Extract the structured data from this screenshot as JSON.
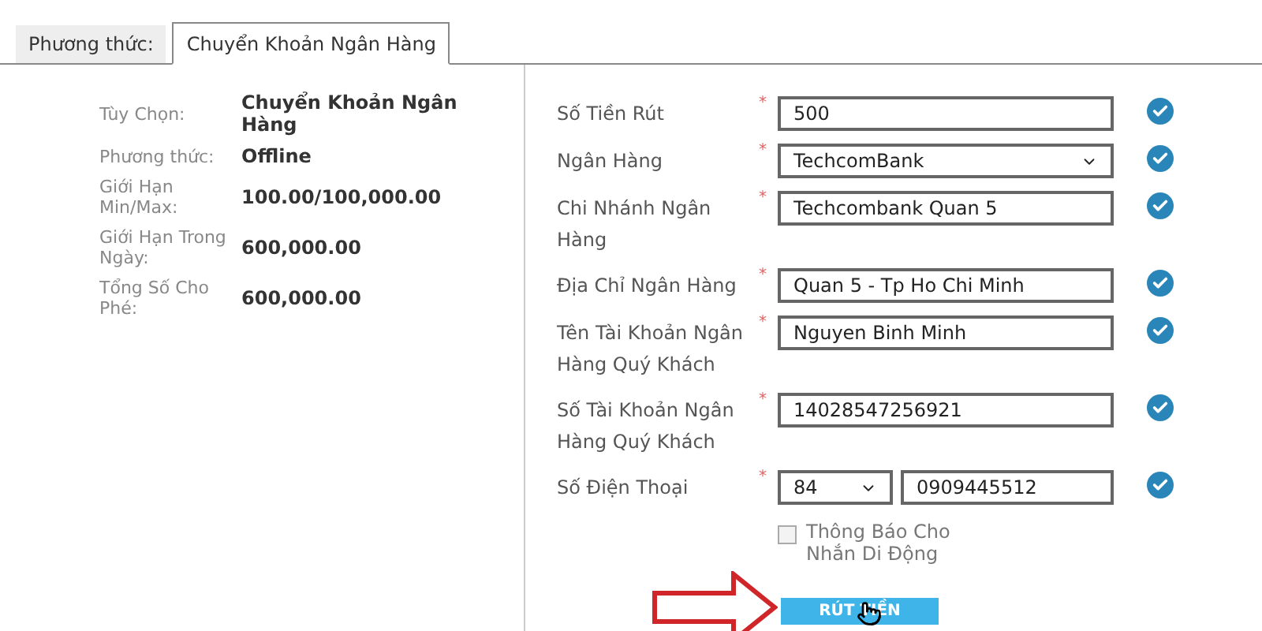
{
  "tabs": [
    {
      "label": "Phương thức:",
      "selected": false
    },
    {
      "label": "Chuyển Khoản Ngân Hàng",
      "selected": true
    }
  ],
  "summary": [
    {
      "label": "Tùy Chọn:",
      "value": "Chuyển Khoản Ngân Hàng"
    },
    {
      "label": "Phương thức:",
      "value": "Offline"
    },
    {
      "label": "Giới Hạn Min/Max:",
      "value": "100.00/100,000.00"
    },
    {
      "label": "Giới Hạn Trong Ngày:",
      "value": "600,000.00"
    },
    {
      "label": "Tổng Số Cho Phé:",
      "value": "600,000.00"
    }
  ],
  "form": [
    {
      "kind": "text",
      "label": "Số Tiền Rút",
      "required": "*",
      "value": "500",
      "valid": true
    },
    {
      "kind": "select",
      "label": "Ngân Hàng",
      "required": "*",
      "value": "TechcomBank",
      "valid": true
    },
    {
      "kind": "text",
      "label": "Chi Nhánh Ngân Hàng",
      "required": "*",
      "value": "Techcombank Quan 5",
      "valid": true
    },
    {
      "kind": "text",
      "label": "Địa Chỉ Ngân Hàng",
      "required": "*",
      "value": "Quan 5 - Tp Ho Chi Minh",
      "valid": true
    },
    {
      "kind": "text",
      "label": "Tên Tài Khoản Ngân Hàng Quý Khách",
      "required": "*",
      "value": "Nguyen Binh Minh",
      "valid": true
    },
    {
      "kind": "text",
      "label": "Số Tài Khoản Ngân Hàng Quý Khách",
      "required": "*",
      "value": "14028547256921",
      "valid": true
    },
    {
      "kind": "phone",
      "label": "Số Điện Thoại",
      "required": "*",
      "code": "84",
      "value": "0909445512",
      "valid": true
    }
  ],
  "sms_option": {
    "checked": false,
    "label_lines": [
      "Thông Báo Cho",
      "Nhắn Di Động"
    ]
  },
  "submit": "RÚT TIỀN"
}
